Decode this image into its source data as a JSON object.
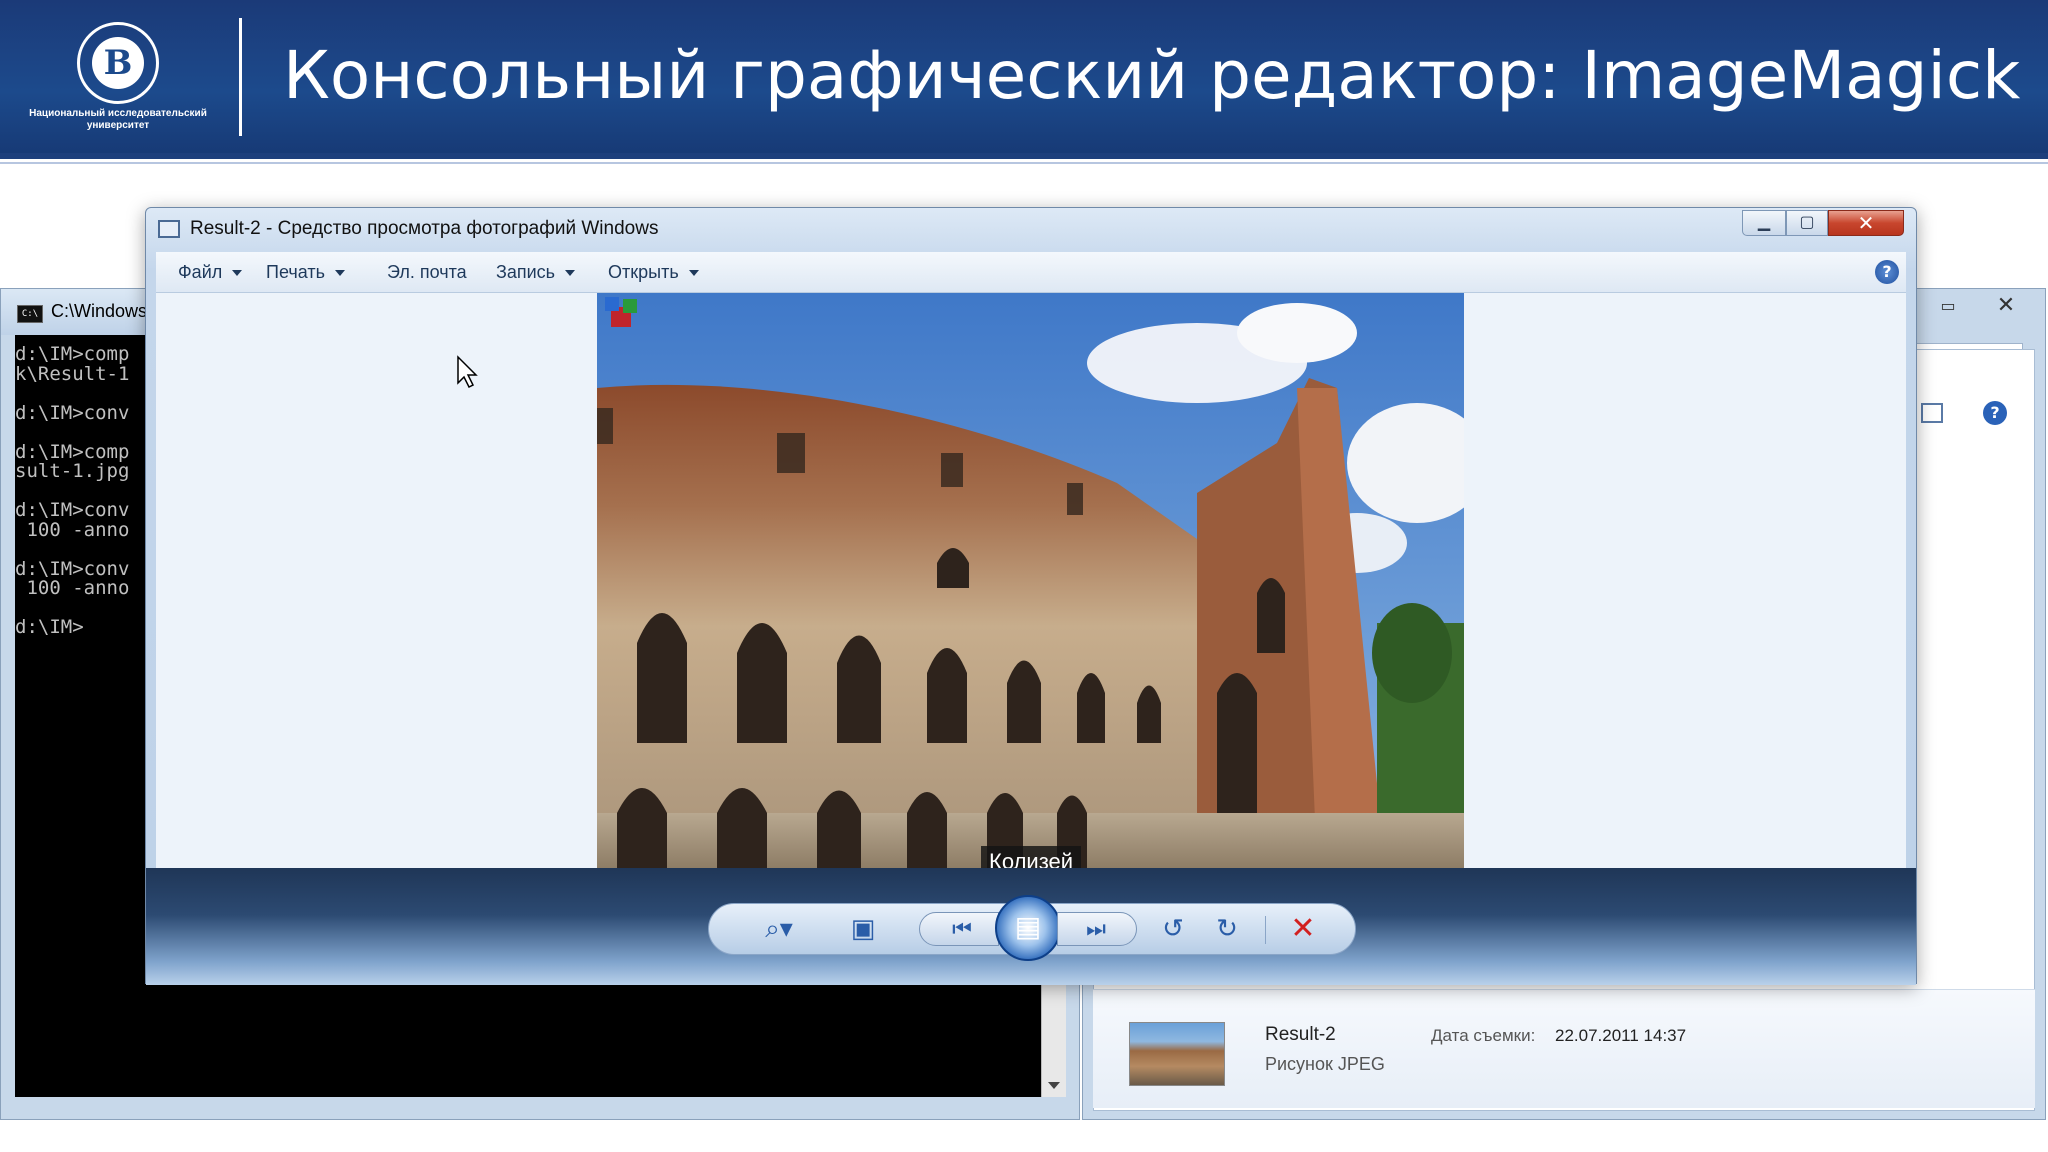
{
  "slide": {
    "title": "Консольный графический редактор: ImageMagick",
    "logo_letter": "В",
    "logo_text_line1": "Национальный исследовательский",
    "logo_text_line2": "университет"
  },
  "console_window": {
    "title": "C:\\Windows",
    "lines": [
      "d:\\IM>comp",
      "k\\Result-1",
      "",
      "d:\\IM>conv",
      "",
      "d:\\IM>comp",
      "sult-1.jpg",
      "",
      "d:\\IM>conv",
      " 100 -anno",
      "",
      "d:\\IM>conv",
      " 100 -anno",
      "",
      "d:\\IM>"
    ]
  },
  "explorer_window": {
    "details": {
      "file_name": "Result-2",
      "file_type": "Рисунок JPEG",
      "date_label": "Дата съемки:",
      "date_value": "22.07.2011 14:37"
    }
  },
  "viewer_window": {
    "title": "Result-2 - Средство просмотра фотографий Windows",
    "menu": {
      "file": "Файл",
      "print": "Печать",
      "email": "Эл. почта",
      "burn": "Запись",
      "open": "Открыть"
    },
    "caption": "Колизей",
    "icons": {
      "zoom": "magnifier-icon",
      "fit": "actual-size-icon",
      "previous": "previous-icon",
      "slideshow": "slideshow-icon",
      "next": "next-icon",
      "rotate_left": "rotate-ccw-icon",
      "rotate_right": "rotate-cw-icon",
      "delete": "delete-icon"
    }
  },
  "colors": {
    "slide_header": "#1c4a8c",
    "console_bg": "#000000",
    "delete_red": "#d22020",
    "accent_blue": "#2a5da8"
  }
}
